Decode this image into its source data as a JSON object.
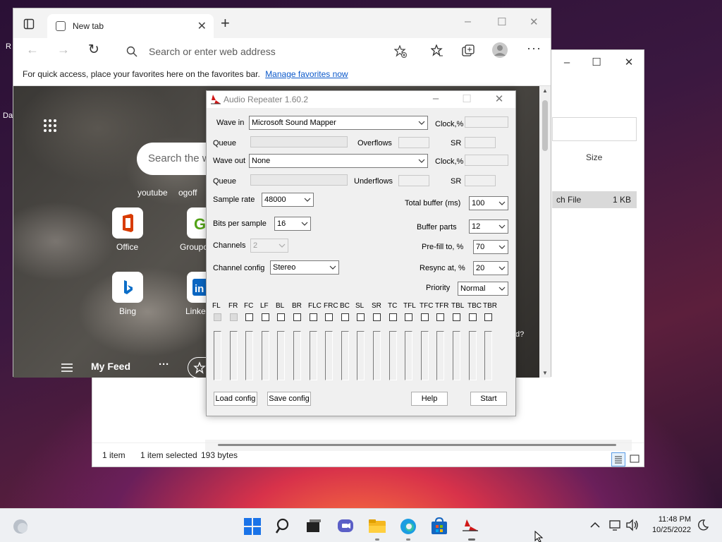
{
  "desktop": {
    "label_r": "R",
    "label_da": "Da"
  },
  "explorer": {
    "size_header": "Size",
    "row_name": "ch File",
    "row_size": "1 KB",
    "status_items": "1 item",
    "status_selected": "1 item selected",
    "status_bytes": "193 bytes"
  },
  "edge": {
    "tab_title": "New tab",
    "address_placeholder": "Search or enter web address",
    "favbar_text": "For quick access, place your favorites here on the favorites bar.",
    "favbar_link": "Manage favorites now",
    "search_placeholder": "Search the w",
    "quick_links": [
      "youtube",
      "ogoff"
    ],
    "tiles": [
      {
        "label": "Office"
      },
      {
        "label": "Groupo"
      },
      {
        "label": "Bing"
      },
      {
        "label": "Linke"
      }
    ],
    "feed_label": "My Feed",
    "feed_more": "···",
    "side_text": "d?"
  },
  "audio_repeater": {
    "title": "Audio Repeater 1.60.2",
    "wave_in_label": "Wave in",
    "wave_in_value": "Microsoft Sound Mapper",
    "queue_label": "Queue",
    "overflows_label": "Overflows",
    "clock_label": "Clock,%",
    "sr_label": "SR",
    "wave_out_label": "Wave out",
    "wave_out_value": "None",
    "underflows_label": "Underflows",
    "sample_rate_label": "Sample rate",
    "sample_rate_value": "48000",
    "bits_label": "Bits per sample",
    "bits_value": "16",
    "channels_label": "Channels",
    "channels_value": "2",
    "channel_config_label": "Channel config",
    "channel_config_value": "Stereo",
    "total_buffer_label": "Total buffer (ms)",
    "total_buffer_value": "100",
    "buffer_parts_label": "Buffer parts",
    "buffer_parts_value": "12",
    "prefill_label": "Pre-fill to, %",
    "prefill_value": "70",
    "resync_label": "Resync at, %",
    "resync_value": "20",
    "priority_label": "Priority",
    "priority_value": "Normal",
    "channels": [
      "FL",
      "FR",
      "FC",
      "LF",
      "BL",
      "BR",
      "FLC",
      "FRC",
      "BC",
      "SL",
      "SR",
      "TC",
      "TFL",
      "TFC",
      "TFR",
      "TBL",
      "TBC",
      "TBR"
    ],
    "channels_checked": [
      true,
      true,
      false,
      false,
      false,
      false,
      false,
      false,
      false,
      false,
      false,
      false,
      false,
      false,
      false,
      false,
      false,
      false
    ],
    "load_config": "Load config",
    "save_config": "Save config",
    "help": "Help",
    "start": "Start"
  },
  "taskbar": {
    "time": "11:48 PM",
    "date": "10/25/2022"
  },
  "colors": {
    "accent_red": "#d01818",
    "edge_blue": "#0a58ca",
    "windows_blue": "#1a73e8"
  }
}
